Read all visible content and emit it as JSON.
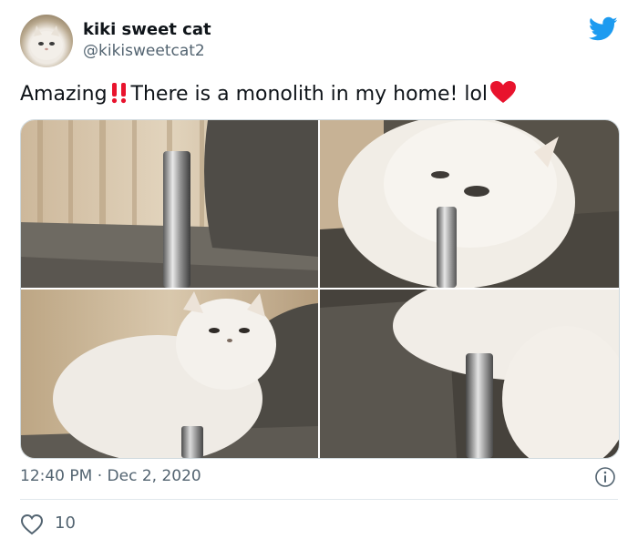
{
  "author": {
    "display_name": "kiki sweet cat",
    "handle": "@kikisweetcat2"
  },
  "tweet": {
    "text_before": "Amazing",
    "text_middle": "There is a monolith in my home!  lol",
    "emoji_1": "double-exclamation-mark",
    "emoji_2": "red-heart"
  },
  "media": {
    "photos": [
      "cat-photo-1",
      "cat-photo-2",
      "cat-photo-3",
      "cat-photo-4"
    ]
  },
  "meta": {
    "time": "12:40 PM",
    "separator": "·",
    "date": "Dec 2, 2020"
  },
  "engagement": {
    "likes": "10"
  },
  "colors": {
    "brand_blue": "#1d9bf0",
    "heart_red": "#e0245e",
    "emoji_red": "#e8132d",
    "text_secondary": "#536471"
  },
  "icons": {
    "brand": "bird-logo-icon",
    "info": "info-icon",
    "like": "heart-outline-icon"
  }
}
